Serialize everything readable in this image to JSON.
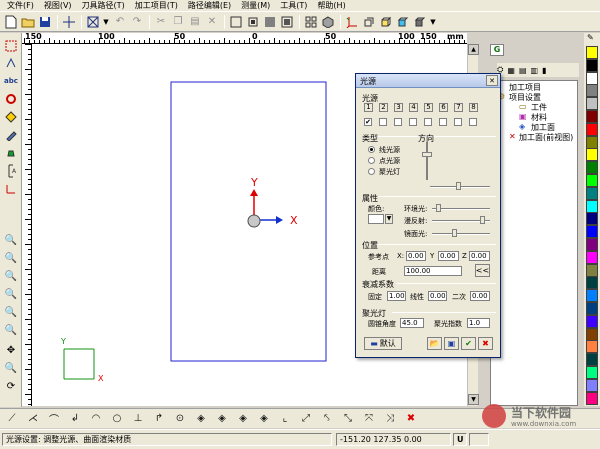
{
  "menu": [
    "文件(F)",
    "视图(V)",
    "刀具路径(T)",
    "加工项目(T)",
    "路径编辑(E)",
    "测量(M)",
    "工具(T)",
    "帮助(H)"
  ],
  "ruler": {
    "labels": [
      "150",
      "100",
      "50",
      "0",
      "50",
      "100",
      "150"
    ],
    "unit": "mm"
  },
  "canvas": {
    "axis_y": "Y",
    "axis_x": "X",
    "small_axis_y": "Y",
    "small_axis_x": "X"
  },
  "dialog": {
    "title": "光源",
    "light_section": "光源",
    "light_numbers": [
      "1",
      "2",
      "3",
      "4",
      "5",
      "6",
      "7",
      "8"
    ],
    "first_checked": "✔",
    "type_label": "类型",
    "direction_label": "方向",
    "types": [
      "线光源",
      "点光源",
      "聚光灯"
    ],
    "attr_label": "属性",
    "color_label": "颜色:",
    "ambient_label": "环境光:",
    "diffuse_label": "漫反射:",
    "specular_label": "镜面光:",
    "pos_label": "位置",
    "ref_point_label": "参考点",
    "x_label": "X:",
    "x_value": "0.00",
    "y_label": "Y",
    "y_value": "0.00",
    "z_label": "Z",
    "z_value": "0.00",
    "distance_label": "距离",
    "distance_value": "100.00",
    "attenuation_label": "衰减系数",
    "fixed_label": "固定",
    "fixed_value": "1.00",
    "linear_label": "线性",
    "linear_value": "0.00",
    "quadratic_label": "二次",
    "quadratic_value": "0.00",
    "spot_label": "聚光灯",
    "cone_label": "圆锥角度",
    "cone_value": "45.0",
    "spot_exp_label": "聚光指数",
    "spot_exp_value": "1.0",
    "default_label": "默认",
    "shift_label": "<<"
  },
  "tree": {
    "tab": "G",
    "root": "加工项目",
    "item1": "项目设置",
    "item2": "工件",
    "item3": "材料",
    "item4": "加工面",
    "item5": "加工面(前视图)"
  },
  "palette": [
    "#ffff00",
    "#000000",
    "#ffffff",
    "#808080",
    "#c0c0c0",
    "#800000",
    "#ff0000",
    "#808000",
    "#ffff00",
    "#008000",
    "#00ff00",
    "#008080",
    "#00ffff",
    "#000080",
    "#0000ff",
    "#800080",
    "#ff00ff",
    "#808040",
    "#004040",
    "#0080ff",
    "#004080",
    "#4000ff",
    "#804000",
    "#ff8040",
    "#004040",
    "#00ff80",
    "#8080ff",
    "#ff0080"
  ],
  "status": {
    "message": "光源设置: 调整光源、曲面渲染材质",
    "coords": "-151.20 127.35 0.00",
    "unit": "U"
  },
  "watermark": {
    "brand": "当下软件园",
    "url": "www.downxia.com"
  }
}
